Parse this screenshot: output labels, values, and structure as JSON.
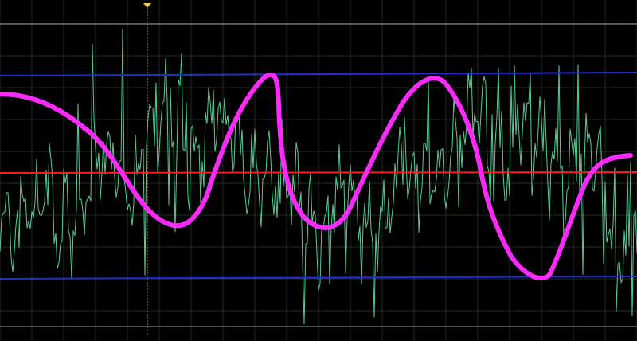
{
  "scope": {
    "colors": {
      "background": "#000000",
      "grid": "#2c3e2c",
      "signal": "#5fe3a8",
      "overlay": "#ff2bff",
      "midline": "#ff1a1a",
      "reference_lines": "#1f2fd6",
      "frame": "#bdbdbd",
      "cursor": "#c9c34a",
      "trigger_marker": "#f2c84b"
    },
    "icons": {
      "trigger_marker": "trigger-marker-icon"
    }
  }
}
